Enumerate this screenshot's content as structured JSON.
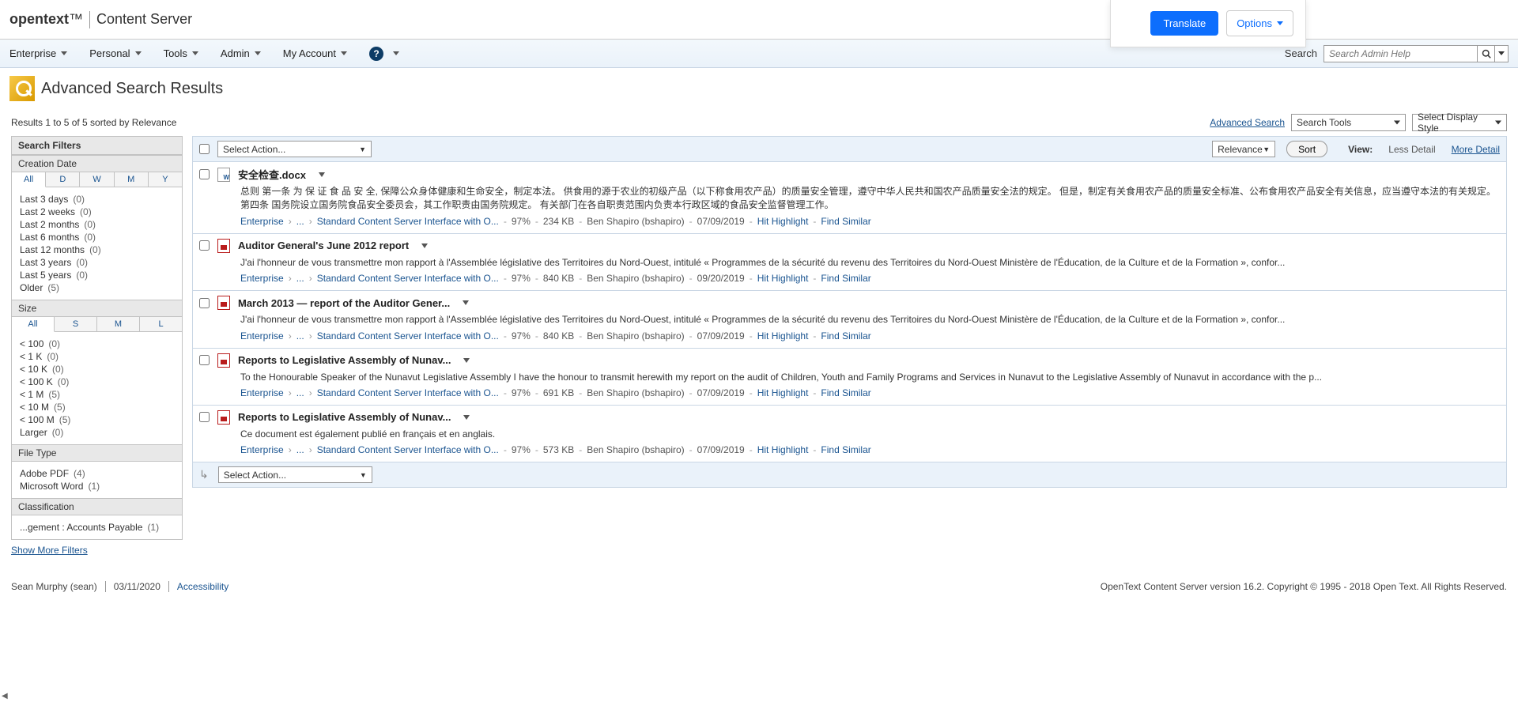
{
  "translate": {
    "translate_label": "Translate",
    "options_label": "Options"
  },
  "brand": {
    "bold": "opentext",
    "tm": "™",
    "product": "Content Server"
  },
  "nav": {
    "items": [
      "Enterprise",
      "Personal",
      "Tools",
      "Admin",
      "My Account"
    ],
    "search_label": "Search",
    "search_placeholder": "Search Admin Help"
  },
  "page_title": "Advanced Search Results",
  "results_header": {
    "summary": "Results 1 to 5 of 5 sorted by Relevance",
    "advanced_search": "Advanced Search",
    "search_tools": "Search Tools",
    "display_style": "Select Display Style"
  },
  "action_bar": {
    "select_action": "Select Action...",
    "relevance": "Relevance",
    "sort": "Sort",
    "view": "View:",
    "less_detail": "Less Detail",
    "more_detail": "More Detail"
  },
  "filters": {
    "title": "Search Filters",
    "creation_date": {
      "header": "Creation Date",
      "tabs": [
        "All",
        "D",
        "W",
        "M",
        "Y"
      ],
      "items": [
        {
          "label": "Last 3 days",
          "count": "(0)"
        },
        {
          "label": "Last 2 weeks",
          "count": "(0)"
        },
        {
          "label": "Last 2 months",
          "count": "(0)"
        },
        {
          "label": "Last 6 months",
          "count": "(0)"
        },
        {
          "label": "Last 12 months",
          "count": "(0)"
        },
        {
          "label": "Last 3 years",
          "count": "(0)"
        },
        {
          "label": "Last 5 years",
          "count": "(0)"
        },
        {
          "label": "Older",
          "count": "(5)"
        }
      ]
    },
    "size": {
      "header": "Size",
      "tabs": [
        "All",
        "S",
        "M",
        "L"
      ],
      "items": [
        {
          "label": "< 100",
          "count": "(0)"
        },
        {
          "label": "< 1 K",
          "count": "(0)"
        },
        {
          "label": "< 10 K",
          "count": "(0)"
        },
        {
          "label": "< 100 K",
          "count": "(0)"
        },
        {
          "label": "< 1 M",
          "count": "(5)"
        },
        {
          "label": "< 10 M",
          "count": "(5)"
        },
        {
          "label": "< 100 M",
          "count": "(5)"
        },
        {
          "label": "Larger",
          "count": "(0)"
        }
      ]
    },
    "file_type": {
      "header": "File Type",
      "items": [
        {
          "label": "Adobe PDF",
          "count": "(4)"
        },
        {
          "label": "Microsoft Word",
          "count": "(1)"
        }
      ]
    },
    "classification": {
      "header": "Classification",
      "items": [
        {
          "label": "...gement : Accounts Payable",
          "count": "(1)"
        }
      ]
    },
    "show_more": "Show More Filters"
  },
  "results": [
    {
      "icon": "word",
      "title": "安全检查.docx",
      "snippet": "总则 第一条 为 保 证 食 品 安 全, 保障公众身体健康和生命安全，制定本法。 供食用的源于农业的初级产品（以下称食用农产品）的质量安全管理，遵守中华人民共和国农产品质量安全法的规定。 但是，制定有关食用农产品的质量安全标准、公布食用农产品安全有关信息，应当遵守本法的有关规定。 第四条 国务院设立国务院食品安全委员会，其工作职责由国务院规定。 有关部门在各自职责范围内负责本行政区域的食品安全监督管理工作。",
      "bc1": "Enterprise",
      "bc2": "...",
      "bc3": "Standard Content Server Interface with O...",
      "pct": "97%",
      "size": "234 KB",
      "owner": "Ben Shapiro (bshapiro)",
      "date": "07/09/2019",
      "hit": "Hit Highlight",
      "similar": "Find Similar"
    },
    {
      "icon": "pdf",
      "title": "Auditor General's June 2012 report",
      "snippet": "J'ai l'honneur de vous transmettre mon rapport à l'Assemblée législative des Territoires du Nord-Ouest, intitulé « Programmes de la sécurité du revenu des Territoires du Nord-Ouest Ministère de l'Éducation, de la Culture et de la Formation », confor...",
      "bc1": "Enterprise",
      "bc2": "...",
      "bc3": "Standard Content Server Interface with O...",
      "pct": "97%",
      "size": "840 KB",
      "owner": "Ben Shapiro (bshapiro)",
      "date": "09/20/2019",
      "hit": "Hit Highlight",
      "similar": "Find Similar"
    },
    {
      "icon": "pdf",
      "title": "March 2013 — report of the Auditor Gener...",
      "snippet": "J'ai l'honneur de vous transmettre mon rapport à l'Assemblée législative des Territoires du Nord-Ouest, intitulé « Programmes de la sécurité du revenu des Territoires du Nord-Ouest Ministère de l'Éducation, de la Culture et de la Formation », confor...",
      "bc1": "Enterprise",
      "bc2": "...",
      "bc3": "Standard Content Server Interface with O...",
      "pct": "97%",
      "size": "840 KB",
      "owner": "Ben Shapiro (bshapiro)",
      "date": "07/09/2019",
      "hit": "Hit Highlight",
      "similar": "Find Similar"
    },
    {
      "icon": "pdf",
      "title": "Reports to Legislative Assembly of Nunav...",
      "snippet": "To the Honourable Speaker of the Nunavut Legislative Assembly I have the honour to transmit herewith my report on the audit of Children, Youth and Family Programs and Services in Nunavut to the Legislative Assembly of Nunavut in accordance with the p...",
      "bc1": "Enterprise",
      "bc2": "...",
      "bc3": "Standard Content Server Interface with O...",
      "pct": "97%",
      "size": "691 KB",
      "owner": "Ben Shapiro (bshapiro)",
      "date": "07/09/2019",
      "hit": "Hit Highlight",
      "similar": "Find Similar"
    },
    {
      "icon": "pdf",
      "title": "Reports to Legislative Assembly of Nunav...",
      "snippet": "Ce document est également publié en français et en anglais.",
      "bc1": "Enterprise",
      "bc2": "...",
      "bc3": "Standard Content Server Interface with O...",
      "pct": "97%",
      "size": "573 KB",
      "owner": "Ben Shapiro (bshapiro)",
      "date": "07/09/2019",
      "hit": "Hit Highlight",
      "similar": "Find Similar"
    }
  ],
  "footer": {
    "user": "Sean Murphy (sean)",
    "date": "03/11/2020",
    "accessibility": "Accessibility",
    "copyright": "OpenText Content Server version 16.2. Copyright © 1995 - 2018 Open Text. All Rights Reserved."
  }
}
